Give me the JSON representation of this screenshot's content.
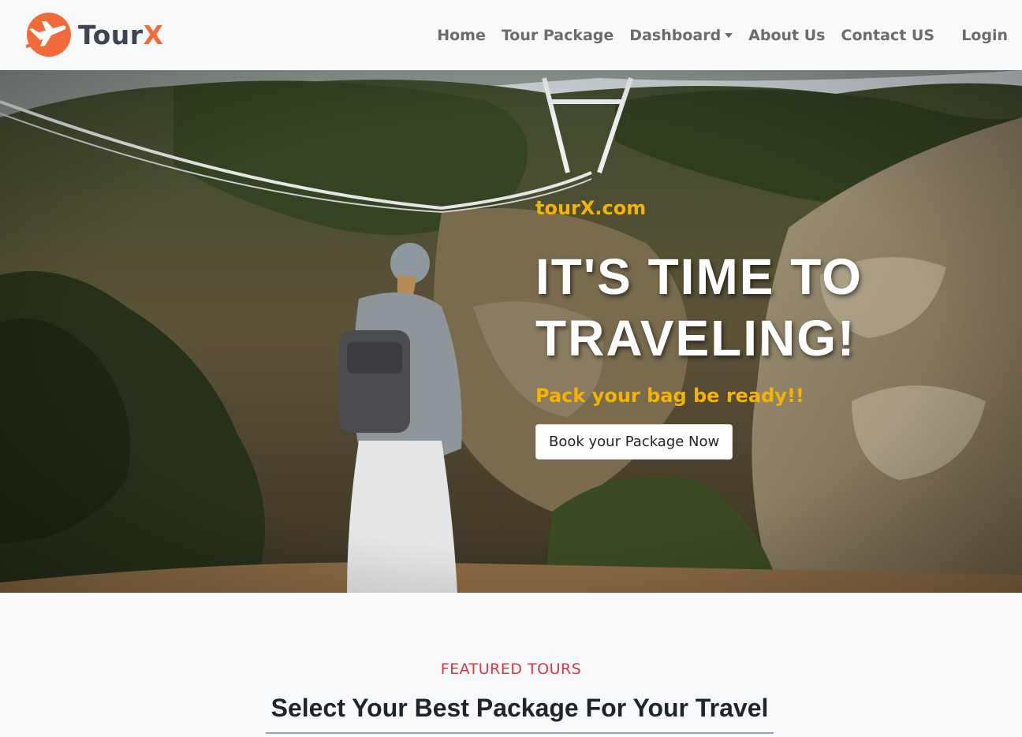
{
  "brand": {
    "name_part1": "Tour",
    "name_part2": "X"
  },
  "nav": {
    "items": [
      {
        "label": "Home"
      },
      {
        "label": "Tour Package"
      },
      {
        "label": "Dashboard"
      },
      {
        "label": "About Us"
      },
      {
        "label": "Contact US"
      }
    ],
    "login": "Login"
  },
  "hero": {
    "tagline": "tourX.com",
    "title_line1": "IT'S TIME TO",
    "title_line2": "TRAVELING!",
    "subtitle": "Pack your bag be ready!!",
    "button": "Book your Package Now"
  },
  "featured": {
    "label": "FEATURED TOURS",
    "title": "Select Your Best Package For Your Travel"
  },
  "colors": {
    "accent": "#f36a3a",
    "tagline_yellow": "#f5b400",
    "featured_red": "#dc3545",
    "nav_text": "#6c6c6c"
  },
  "icons": {
    "logo": "plane-logo-icon",
    "dropdown": "caret-down-icon"
  }
}
